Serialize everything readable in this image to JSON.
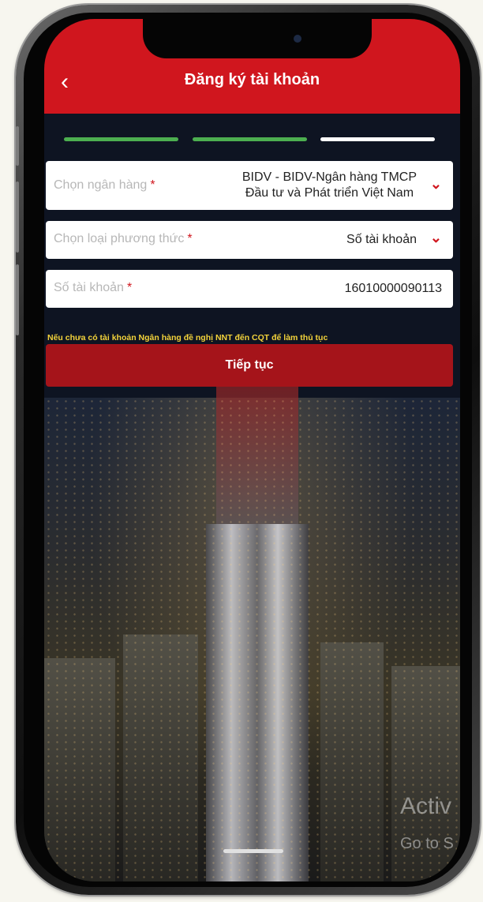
{
  "header": {
    "title": "Đăng ký tài khoản",
    "back_icon": "chevron-left-icon"
  },
  "steps": [
    {
      "state": "done",
      "color": "#4caf50"
    },
    {
      "state": "done",
      "color": "#4caf50"
    },
    {
      "state": "current",
      "color": "#ffffff"
    }
  ],
  "form": {
    "bank": {
      "label": "Chọn ngân hàng",
      "required_mark": "*",
      "value_line1": "BIDV - BIDV-Ngân hàng TMCP",
      "value_line2": "Đầu tư và Phát triển Việt Nam"
    },
    "method": {
      "label": "Chọn loại phương thức",
      "required_mark": "*",
      "value": "Số tài khoản"
    },
    "account": {
      "label": "Số tài khoản",
      "required_mark": "*",
      "value": "16010000090113"
    },
    "note": "Nếu chưa có tài khoản Ngân hàng đề nghị NNT đến CQT để làm thủ tục",
    "continue_label": "Tiếp tục"
  },
  "watermark": {
    "line1": "Activ",
    "line2": "Go to S"
  },
  "colors": {
    "brand_red": "#d0161e",
    "note_yellow": "#f3d33b",
    "progress_green": "#4caf50"
  }
}
